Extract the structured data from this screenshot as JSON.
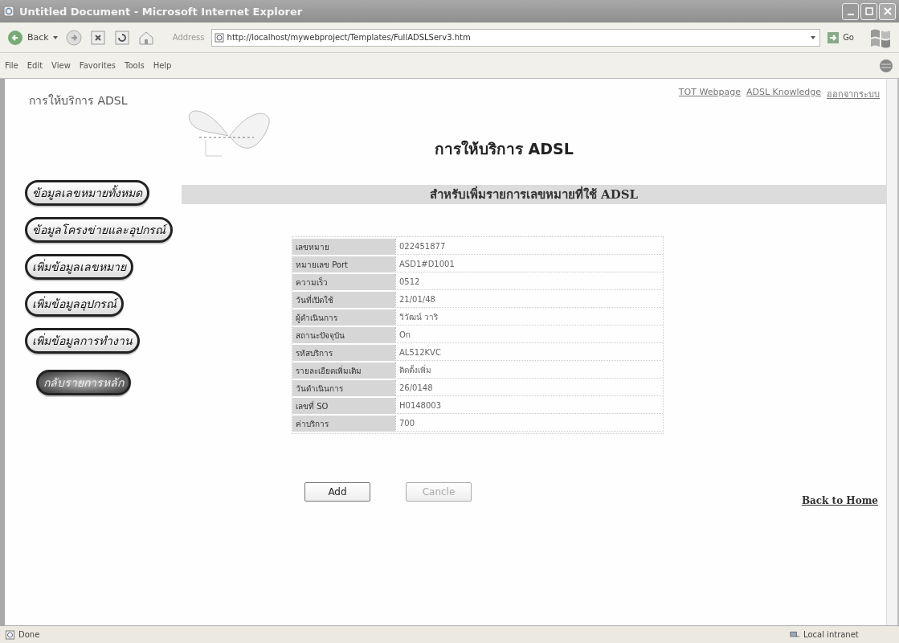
{
  "window": {
    "title": "Untitled Document - Microsoft Internet Explorer"
  },
  "toolbar": {
    "back": "Back",
    "address_label": "Address",
    "url": "http://localhost/mywebproject/Templates/FullADSLServ3.htm",
    "go": "Go"
  },
  "menu": [
    "File",
    "Edit",
    "View",
    "Favorites",
    "Tools",
    "Help"
  ],
  "page": {
    "site_title": "การให้บริการ ADSL",
    "top_links": [
      "TOT Webpage",
      "ADSL Knowledge",
      "ออกจากระบบ"
    ],
    "heading": "การให้บริการ ADSL",
    "section_title": "สำหรับเพิ่มรายการเลขหมายที่ใช้ ADSL",
    "nav": [
      {
        "label": "ข้อมูลเลขหมายทั้งหมด",
        "selected": false
      },
      {
        "label": "ข้อมูลโครงข่ายและอุปกรณ์",
        "selected": false
      },
      {
        "label": "เพิ่มข้อมูลเลขหมาย",
        "selected": false
      },
      {
        "label": "เพิ่มข้อมูลอุปกรณ์",
        "selected": false
      },
      {
        "label": "เพิ่มข้อมูลการทำงาน",
        "selected": false
      },
      {
        "label": "กลับรายการหลัก",
        "selected": true
      }
    ],
    "rows": [
      {
        "label": "เลขหมาย",
        "value": "022451877"
      },
      {
        "label": "หมายเลข Port",
        "value": "ASD1#D1001"
      },
      {
        "label": "ความเร็ว",
        "value": "0512"
      },
      {
        "label": "วันที่เปิดใช้",
        "value": "21/01/48"
      },
      {
        "label": "ผู้ดำเนินการ",
        "value": "วิวัฒน์ วาริ"
      },
      {
        "label": "สถานะปัจจุบัน",
        "value": "On"
      },
      {
        "label": "รหัสบริการ",
        "value": "AL512KVC"
      },
      {
        "label": "รายละเอียดเพิ่มเติม",
        "value": "ติดตั้งเพิ่ม"
      },
      {
        "label": "วันดำเนินการ",
        "value": "26/0148"
      },
      {
        "label": "เลขที่ SO",
        "value": "H0148003"
      },
      {
        "label": "ค่าบริการ",
        "value": "700"
      }
    ],
    "buttons": [
      {
        "label": "Add",
        "disabled": false
      },
      {
        "label": "Cancle",
        "disabled": true
      }
    ],
    "back_link": "Back to Home"
  },
  "status_bar": {
    "left": "Done",
    "right": "Local intranet"
  }
}
